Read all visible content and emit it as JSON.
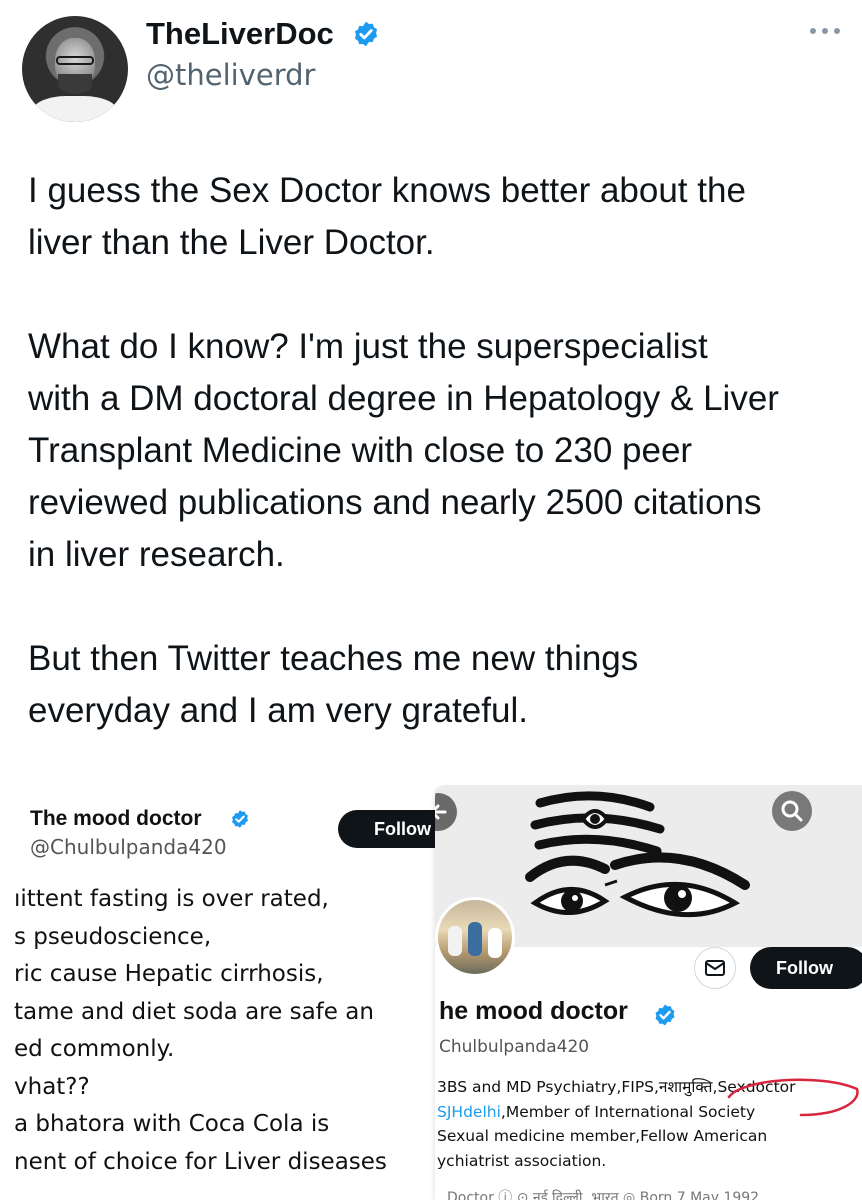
{
  "tweet": {
    "display_name": "TheLiverDoc",
    "handle": "@theliverdr",
    "verified_color": "#1d9bf0",
    "paragraphs": [
      [
        "I guess the Sex Doctor knows better about the",
        "liver than the Liver Doctor."
      ],
      [
        "What do I know? I'm just the superspecialist",
        "with a DM doctoral degree in Hepatology & Liver",
        "Transplant Medicine with close to 230 peer",
        "reviewed publications and nearly 2500 citations",
        "in liver research."
      ],
      [
        "But then Twitter teaches me new things",
        "everyday and I am very grateful."
      ]
    ]
  },
  "embedded_image": {
    "left_card": {
      "name": "The mood doctor",
      "handle": "@Chulbulpanda420",
      "follow_label": "Follow",
      "lines": [
        "ıittent fasting is over rated,",
        "s pseudoscience,",
        "ric cause Hepatic cirrhosis,",
        "tame and diet soda are safe an",
        "ed commonly.",
        "vhat??",
        "a bhatora with Coca Cola is",
        "nent of choice for Liver diseases"
      ]
    },
    "right_card": {
      "name": "he mood doctor",
      "handle": "Chulbulpanda420",
      "follow_label": "Follow",
      "bio_line_1": "3BS and MD Psychiatry,FIPS,नशामुक्ति,Sexdoctor",
      "bio_line_2_link": "SJHdelhi",
      "bio_line_2_rest": ",Member of International Society",
      "bio_line_3": "Sexual medicine member,Fellow American",
      "bio_line_4": "ychiatrist association.",
      "meta": "Doctor ⓘ   ⊙ नई दिल्ली, भारत   ◎ Born 7 May 1992",
      "annotation_color": "#d7263d"
    }
  }
}
